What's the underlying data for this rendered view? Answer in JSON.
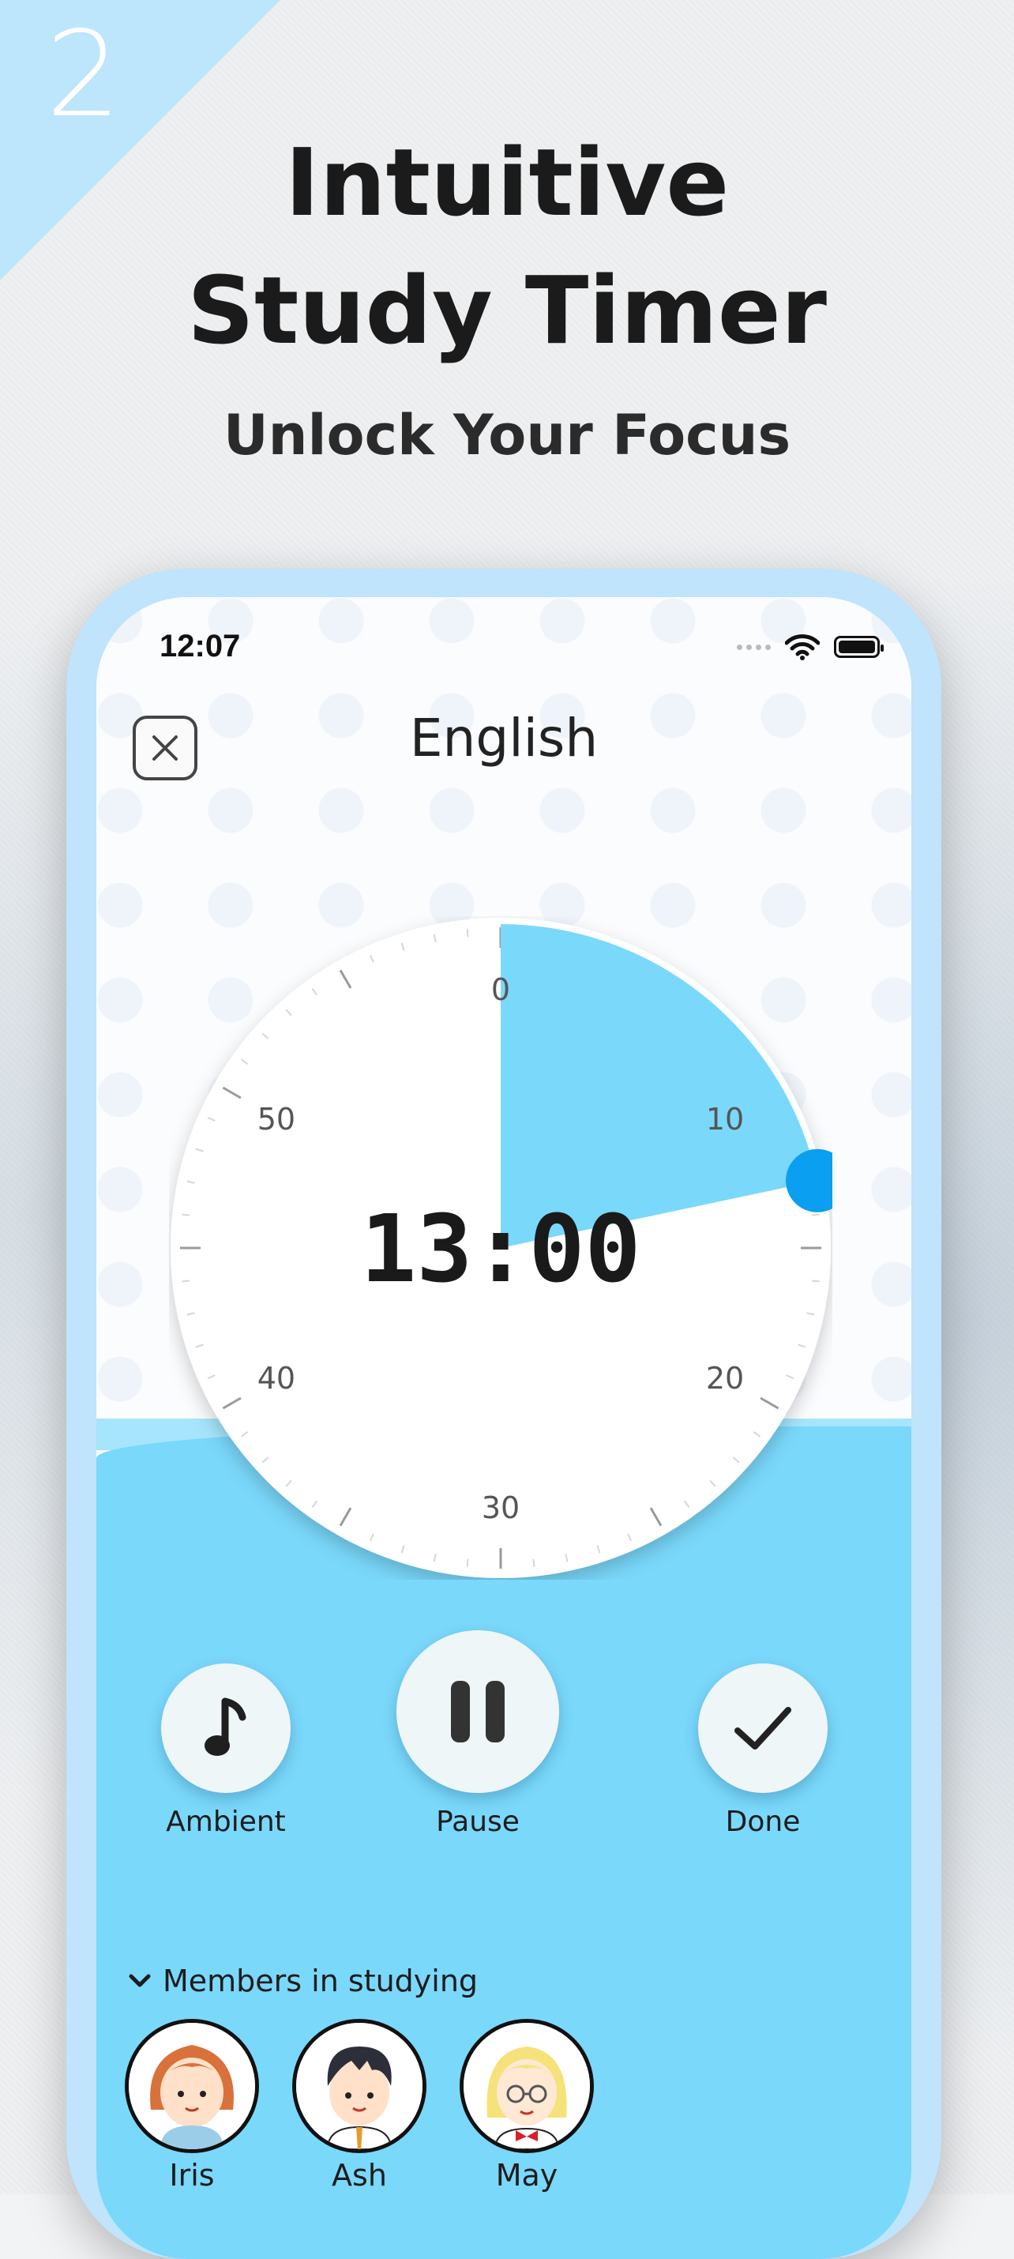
{
  "badge": {
    "number": "2"
  },
  "headline": {
    "line1": "Intuitive",
    "line2": "Study Timer"
  },
  "subheadline": "Unlock Your Focus",
  "status_bar": {
    "time": "12:07"
  },
  "screen": {
    "title": "English"
  },
  "timer": {
    "display": "13:00",
    "dial_labels": [
      "0",
      "10",
      "20",
      "30",
      "40",
      "50"
    ],
    "remaining_minutes": 13,
    "accent": "#7ad8fb",
    "handle_color": "#0a9ff0"
  },
  "controls": {
    "ambient_label": "Ambient",
    "pause_label": "Pause",
    "done_label": "Done"
  },
  "members": {
    "heading": "Members in studying",
    "list": [
      {
        "name": "Iris"
      },
      {
        "name": "Ash"
      },
      {
        "name": "May"
      }
    ]
  },
  "colors": {
    "corner": "#bde5fb",
    "phone_frame": "#bfe4fb",
    "lower_panel": "#7ad8fb"
  }
}
